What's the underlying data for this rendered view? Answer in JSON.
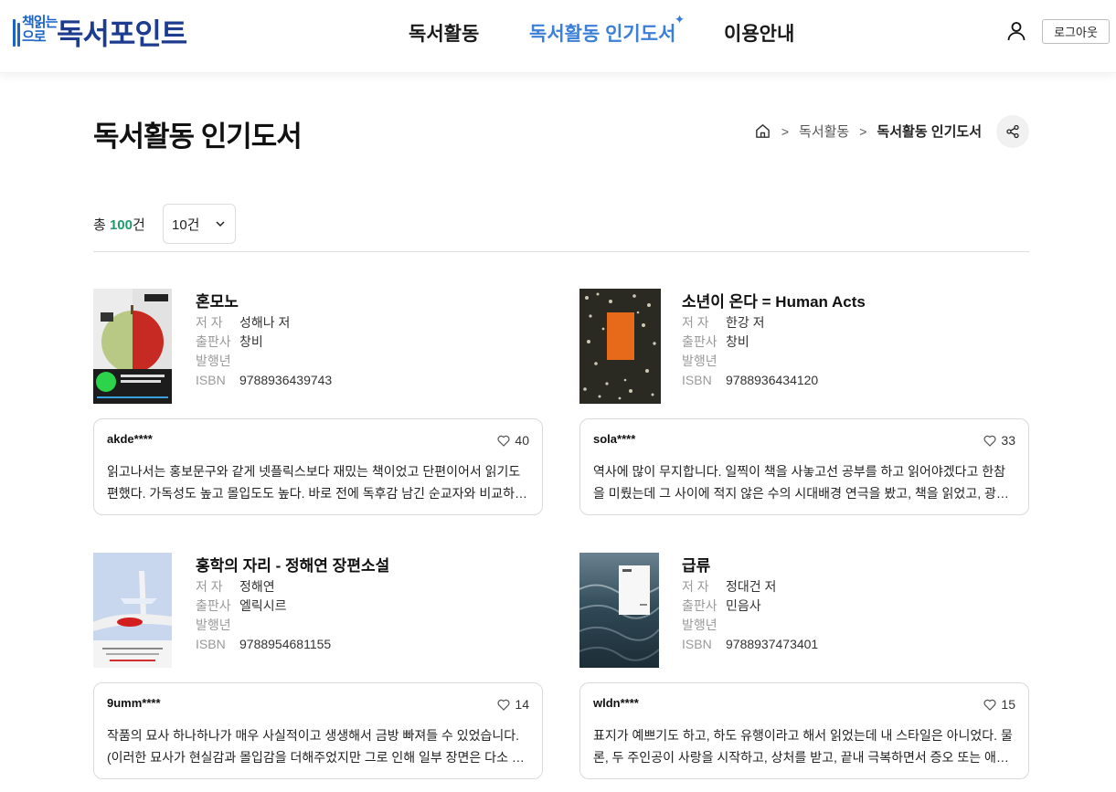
{
  "header": {
    "logo_mark": "책읽는\n으로",
    "logo_title": "독서포인트",
    "nav": [
      "독서활동",
      "독서활동 인기도서",
      "이용안내"
    ],
    "nav_active_index": 1,
    "logout_label": "로그아웃",
    "accent_color": "#3b7fd8"
  },
  "page": {
    "title": "독서활동 인기도서",
    "breadcrumb": [
      "독서활동",
      "독서활동 인기도서"
    ]
  },
  "toolbar": {
    "total_prefix": "총 ",
    "total_count": "100",
    "total_suffix": "건",
    "page_size": "10건"
  },
  "labels": {
    "author": "저 자",
    "publisher": "출판사",
    "year": "발행년",
    "isbn": "ISBN"
  },
  "books": [
    {
      "title": "혼모노",
      "author": "성해나 저",
      "publisher": "창비",
      "year": "",
      "isbn": "9788936439743",
      "review": {
        "user": "akde****",
        "likes": "40",
        "text": "읽고나서는 홍보문구와 같게 넷플릭스보다 재밌는 책이었고 단편이어서 읽기도 편했다. 가독성도 높고 몰입도도 높다. 바로 전에 독후감 남긴 순교자와 비교하면 정말 읽기 편한 책이었다."
      }
    },
    {
      "title": "소년이 온다 = Human Acts",
      "author": "한강 저",
      "publisher": "창비",
      "year": "",
      "isbn": "9788936434120",
      "review": {
        "user": "sola****",
        "likes": "33",
        "text": "역사에 많이 무지합니다. 일찍이 책을 사놓고선 공부를 하고 읽어야겠다고 한참을 미뤘는데 그 사이에 적지 않은 수의 시대배경 연극을 봤고, 책을 읽었고, 광주에 다녀왔습니다."
      }
    },
    {
      "title": "홍학의 자리 - 정해연 장편소설",
      "author": "정해연",
      "publisher": "엘릭시르",
      "year": "",
      "isbn": "9788954681155",
      "review": {
        "user": "9umm****",
        "likes": "14",
        "text": "작품의 묘사 하나하나가 매우 사실적이고 생생해서 금방 빠져들 수 있었습니다. (이러한 묘사가 현실감과 몰입감을 더해주었지만 그로 인해 일부 장면은 다소 불편하게 느껴지기도 했습니다.)"
      }
    },
    {
      "title": "급류",
      "author": "정대건 저",
      "publisher": "민음사",
      "year": "",
      "isbn": "9788937473401",
      "review": {
        "user": "wldn****",
        "likes": "15",
        "text": "표지가 예쁘기도 하고, 하도 유행이라고 해서 읽었는데 내 스타일은 아니었다. 물론, 두 주인공이 사랑을 시작하고, 상처를 받고, 끝내 극복하면서 증오 또는 애정으로 남는 과정이 인상적이었다."
      }
    }
  ]
}
